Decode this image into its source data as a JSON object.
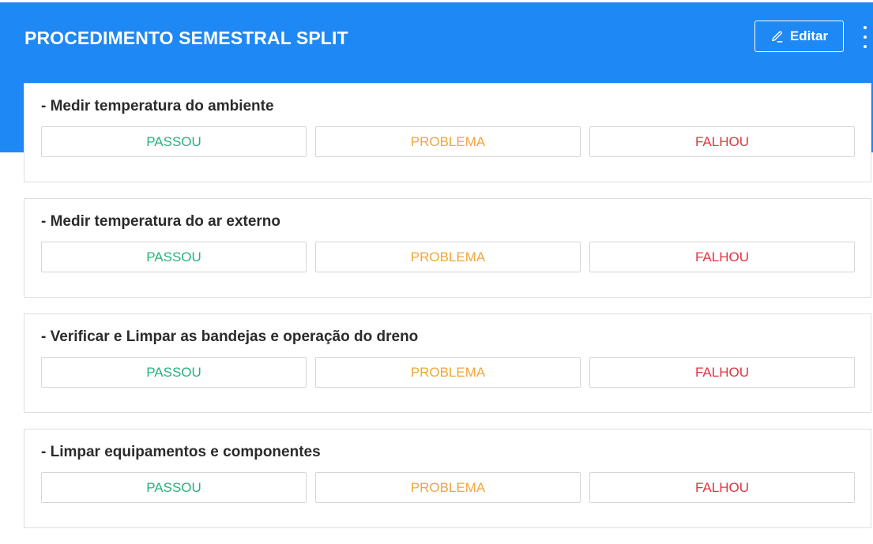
{
  "header": {
    "title": "PROCEDIMENTO SEMESTRAL SPLIT",
    "edit_label": "Editar",
    "edit_icon": "pencil-icon",
    "more_icon": "more-vertical-icon"
  },
  "options": {
    "pass_label": "PASSOU",
    "problem_label": "PROBLEMA",
    "fail_label": "FALHOU"
  },
  "items": [
    {
      "label": "- Medir temperatura do ambiente"
    },
    {
      "label": "- Medir temperatura do ar externo"
    },
    {
      "label": "- Verificar e Limpar as bandejas e operação do dreno"
    },
    {
      "label": "- Limpar equipamentos e componentes"
    }
  ],
  "colors": {
    "brand": "#1e88f5",
    "pass": "#26b27a",
    "problem": "#f0a63a",
    "fail": "#e2343f"
  }
}
